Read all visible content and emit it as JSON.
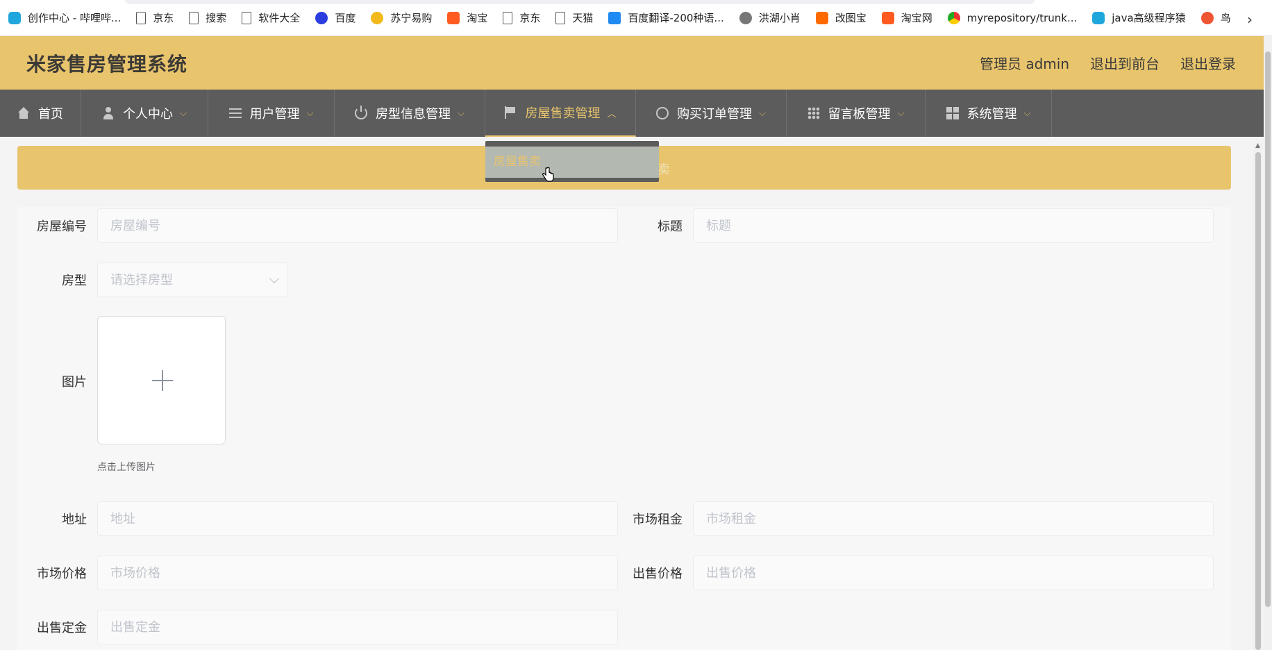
{
  "bookmarks": [
    {
      "label": "创作中心 - 哔哩哔...",
      "icon": "bilibili-icon"
    },
    {
      "label": "京东",
      "icon": "page-icon"
    },
    {
      "label": "搜索",
      "icon": "page-icon"
    },
    {
      "label": "软件大全",
      "icon": "page-icon"
    },
    {
      "label": "百度",
      "icon": "baidu-icon"
    },
    {
      "label": "苏宁易购",
      "icon": "suning-icon"
    },
    {
      "label": "淘宝",
      "icon": "taobao-icon"
    },
    {
      "label": "京东",
      "icon": "page-icon"
    },
    {
      "label": "天猫",
      "icon": "page-icon"
    },
    {
      "label": "百度翻译-200种语...",
      "icon": "fanyi-icon"
    },
    {
      "label": "洪湖小肖",
      "icon": "avatar-icon"
    },
    {
      "label": "改图宝",
      "icon": "gaitubao-icon"
    },
    {
      "label": "淘宝网",
      "icon": "taobao-icon"
    },
    {
      "label": "myrepository/trunk...",
      "icon": "chrome-icon"
    },
    {
      "label": "java高级程序猿",
      "icon": "bilibili-icon"
    },
    {
      "label": "鸟",
      "icon": "bird-icon"
    }
  ],
  "bookmarks_more": "›",
  "header": {
    "title": "米家售房管理系统",
    "admin_label": "管理员 admin",
    "to_front": "退出到前台",
    "logout": "退出登录"
  },
  "nav": {
    "items": [
      {
        "label": "首页",
        "icon": "home-icon"
      },
      {
        "label": "个人中心",
        "icon": "user-icon"
      },
      {
        "label": "用户管理",
        "icon": "list-icon"
      },
      {
        "label": "房型信息管理",
        "icon": "power-icon"
      },
      {
        "label": "房屋售卖管理",
        "icon": "flag-icon"
      },
      {
        "label": "购买订单管理",
        "icon": "gauge-icon"
      },
      {
        "label": "留言板管理",
        "icon": "grid-icon"
      },
      {
        "label": "系统管理",
        "icon": "apps-icon"
      }
    ],
    "chevron_down": "⌵",
    "chevron_up": "︿",
    "dropdown_item": "房屋售卖"
  },
  "breadcrumb": "卖",
  "form": {
    "house_no": {
      "label": "房屋编号",
      "placeholder": "房屋编号"
    },
    "title": {
      "label": "标题",
      "placeholder": "标题"
    },
    "house_type": {
      "label": "房型",
      "placeholder": "请选择房型"
    },
    "image": {
      "label": "图片",
      "tip": "点击上传图片"
    },
    "address": {
      "label": "地址",
      "placeholder": "地址"
    },
    "market_rent": {
      "label": "市场租金",
      "placeholder": "市场租金"
    },
    "market_price": {
      "label": "市场价格",
      "placeholder": "市场价格"
    },
    "sale_price": {
      "label": "出售价格",
      "placeholder": "出售价格"
    },
    "sale_deposit": {
      "label": "出售定金",
      "placeholder": "出售定金"
    }
  },
  "colors": {
    "accent": "#e8c46d",
    "nav_bg": "#5c5c5c"
  }
}
